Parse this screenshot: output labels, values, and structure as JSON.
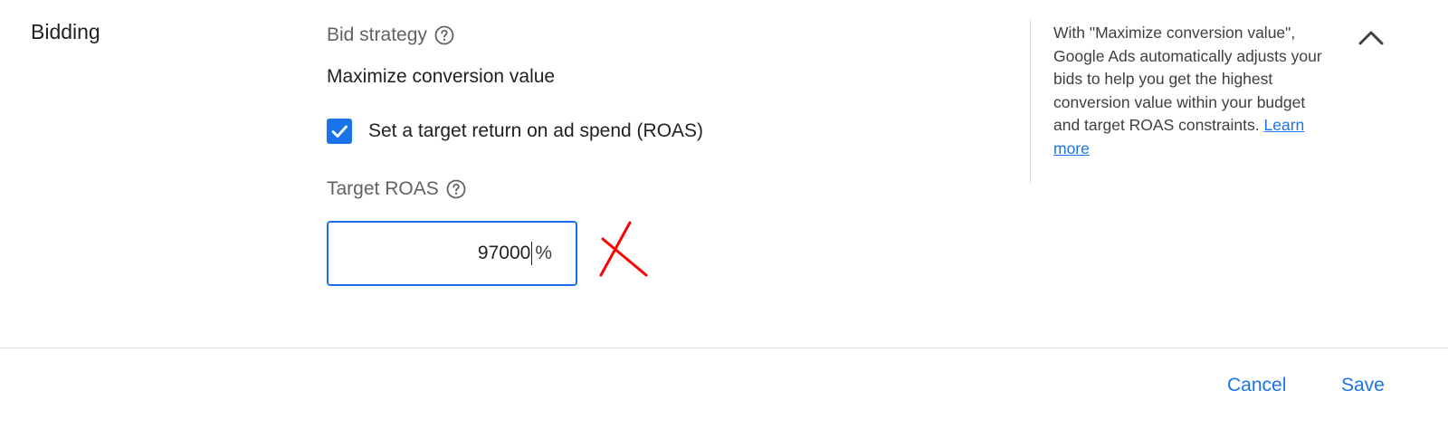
{
  "section": {
    "title": "Bidding"
  },
  "bid_strategy": {
    "label": "Bid strategy",
    "value": "Maximize conversion value",
    "help_icon": "help-circle-icon"
  },
  "roas_checkbox": {
    "label": "Set a target return on ad spend (ROAS)",
    "checked": true,
    "icon": "checkmark-icon"
  },
  "target_roas": {
    "label": "Target ROAS",
    "help_icon": "help-circle-icon",
    "value": "97000",
    "unit": "%"
  },
  "help_panel": {
    "text": "With \"Maximize conversion value\", Google Ads automatically adjusts your bids to help you get the highest conversion value within your budget and target ROAS constraints.",
    "link": "Learn more"
  },
  "collapse_icon": "chevron-up-icon",
  "annotation_icon": "red-x-mark",
  "footer": {
    "cancel_label": "Cancel",
    "save_label": "Save"
  },
  "colors": {
    "accent": "#1a73e8",
    "annotation": "#ff0000",
    "text_primary": "#202124",
    "text_secondary": "#5f6368",
    "divider": "#dadce0"
  }
}
